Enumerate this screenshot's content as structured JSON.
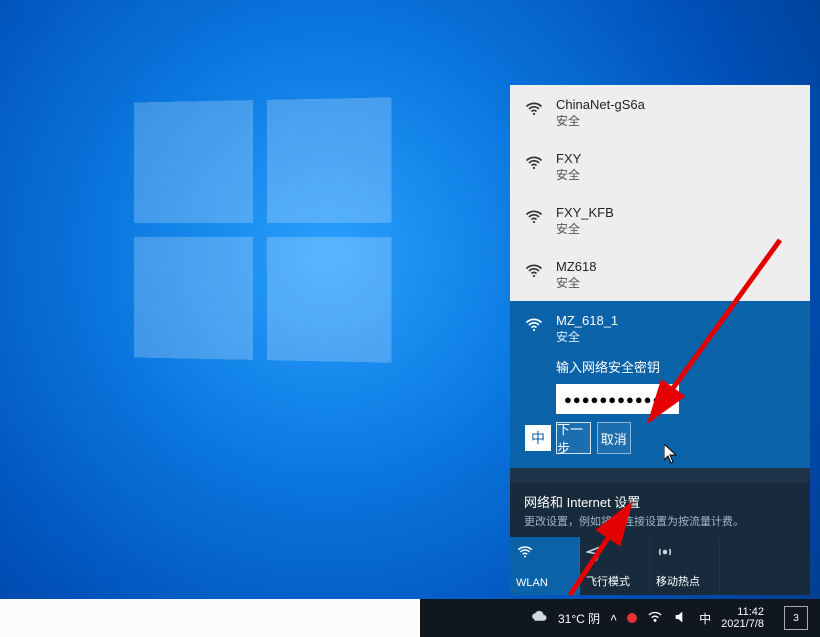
{
  "networks": [
    {
      "name": "ChinaNet-gS6a",
      "status": "安全"
    },
    {
      "name": "FXY",
      "status": "安全"
    },
    {
      "name": "FXY_KFB",
      "status": "安全"
    },
    {
      "name": "MZ618",
      "status": "安全"
    }
  ],
  "selected_network": {
    "name": "MZ_618_1",
    "status": "安全",
    "prompt": "输入网络安全密钥",
    "password_mask": "●●●●●●●●●●●●",
    "ime_badge": "中",
    "next_button": "下一步",
    "cancel_button": "取消"
  },
  "settings_link": {
    "title": "网络和 Internet 设置",
    "desc": "更改设置，例如将某连接设置为按流量计费。"
  },
  "quick_actions": {
    "wlan": "WLAN",
    "airplane": "飞行模式",
    "hotspot": "移动热点"
  },
  "taskbar": {
    "weather": "31°C 阴",
    "ime": "中",
    "time": "11:42",
    "date": "2021/7/8",
    "notif_badge": "3"
  },
  "icons": {
    "wifi": "wifi-icon",
    "eye": "reveal-password-icon",
    "chevron_up": "chevron-up-icon",
    "airplane": "airplane-icon",
    "hotspot": "hotspot-icon",
    "cloud": "weather-icon",
    "speaker": "speaker-icon",
    "notification": "notification-icon"
  }
}
